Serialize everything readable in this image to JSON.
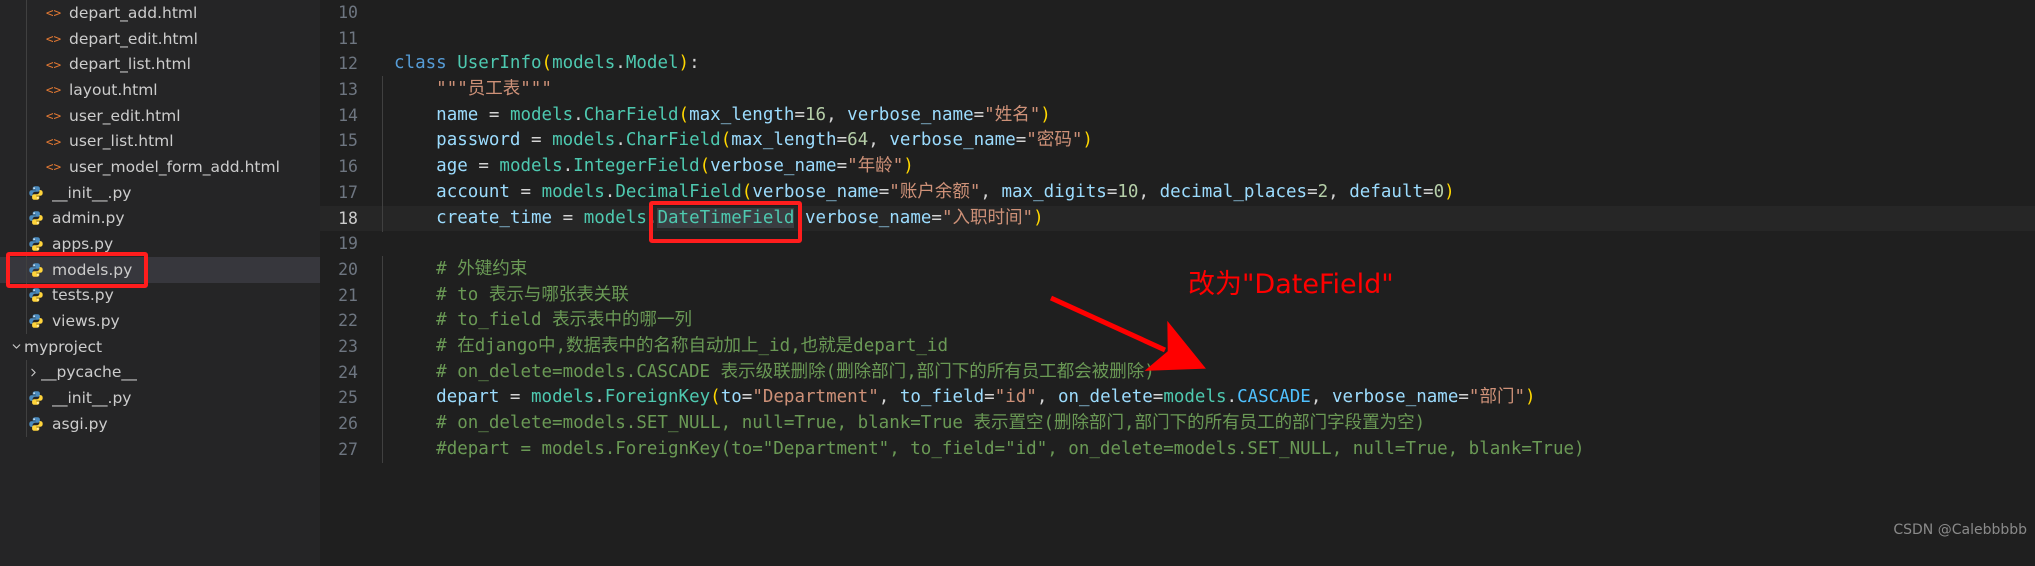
{
  "sidebar": {
    "items": [
      {
        "label": "depart_add.html",
        "icon": "html-icon",
        "indent": 2,
        "type": "html",
        "selected": false
      },
      {
        "label": "depart_edit.html",
        "icon": "html-icon",
        "indent": 2,
        "type": "html",
        "selected": false
      },
      {
        "label": "depart_list.html",
        "icon": "html-icon",
        "indent": 2,
        "type": "html",
        "selected": false
      },
      {
        "label": "layout.html",
        "icon": "html-icon",
        "indent": 2,
        "type": "html",
        "selected": false
      },
      {
        "label": "user_edit.html",
        "icon": "html-icon",
        "indent": 2,
        "type": "html",
        "selected": false
      },
      {
        "label": "user_list.html",
        "icon": "html-icon",
        "indent": 2,
        "type": "html",
        "selected": false
      },
      {
        "label": "user_model_form_add.html",
        "icon": "html-icon",
        "indent": 2,
        "type": "html",
        "selected": false
      },
      {
        "label": "__init__.py",
        "icon": "python-icon",
        "indent": 1,
        "type": "py",
        "selected": false
      },
      {
        "label": "admin.py",
        "icon": "python-icon",
        "indent": 1,
        "type": "py",
        "selected": false
      },
      {
        "label": "apps.py",
        "icon": "python-icon",
        "indent": 1,
        "type": "py",
        "selected": false
      },
      {
        "label": "models.py",
        "icon": "python-icon",
        "indent": 1,
        "type": "py",
        "selected": true
      },
      {
        "label": "tests.py",
        "icon": "python-icon",
        "indent": 1,
        "type": "py",
        "selected": false
      },
      {
        "label": "views.py",
        "icon": "python-icon",
        "indent": 1,
        "type": "py",
        "selected": false
      },
      {
        "label": "myproject",
        "icon": "chevron-down-icon",
        "indent": 0,
        "type": "folder-open",
        "selected": false
      },
      {
        "label": "__pycache__",
        "icon": "chevron-right-icon",
        "indent": 1,
        "type": "folder-closed",
        "selected": false
      },
      {
        "label": "__init__.py",
        "icon": "python-icon",
        "indent": 1,
        "type": "py",
        "selected": false
      },
      {
        "label": "asgi.py",
        "icon": "python-icon",
        "indent": 1,
        "type": "py",
        "selected": false
      }
    ],
    "highlight_target": "models.py"
  },
  "editor": {
    "first_line_number": 10,
    "current_line": 18,
    "selected_token": "DateTimeField",
    "lines": [
      {
        "n": 10,
        "text": ""
      },
      {
        "n": 11,
        "text": ""
      },
      {
        "n": 12,
        "text": "class UserInfo(models.Model):"
      },
      {
        "n": 13,
        "text": "    \"\"\"员工表\"\"\""
      },
      {
        "n": 14,
        "text": "    name = models.CharField(max_length=16, verbose_name=\"姓名\")"
      },
      {
        "n": 15,
        "text": "    password = models.CharField(max_length=64, verbose_name=\"密码\")"
      },
      {
        "n": 16,
        "text": "    age = models.IntegerField(verbose_name=\"年龄\")"
      },
      {
        "n": 17,
        "text": "    account = models.DecimalField(verbose_name=\"账户余额\", max_digits=10, decimal_places=2, default=0)"
      },
      {
        "n": 18,
        "text": "    create_time = models.DateTimeField(verbose_name=\"入职时间\")"
      },
      {
        "n": 19,
        "text": ""
      },
      {
        "n": 20,
        "text": "    # 外键约束"
      },
      {
        "n": 21,
        "text": "    # to 表示与哪张表关联"
      },
      {
        "n": 22,
        "text": "    # to_field 表示表中的哪一列"
      },
      {
        "n": 23,
        "text": "    # 在django中,数据表中的名称自动加上_id,也就是depart_id"
      },
      {
        "n": 24,
        "text": "    # on_delete=models.CASCADE 表示级联删除(删除部门,部门下的所有员工都会被删除)"
      },
      {
        "n": 25,
        "text": "    depart = models.ForeignKey(to=\"Department\", to_field=\"id\", on_delete=models.CASCADE, verbose_name=\"部门\")"
      },
      {
        "n": 26,
        "text": "    # on_delete=models.SET_NULL, null=True, blank=True 表示置空(删除部门,部门下的所有员工的部门字段置为空)"
      },
      {
        "n": 27,
        "text": "    #depart = models.ForeignKey(to=\"Department\", to_field=\"id\", on_delete=models.SET_NULL, null=True, blank=True)"
      }
    ]
  },
  "annotation": {
    "text": "改为\"DateField\"",
    "color": "#ff0000"
  },
  "watermark": {
    "text": "CSDN @Calebbbbb"
  },
  "colors": {
    "background": "#1f1f1f",
    "sidebar_background": "#252526",
    "selection": "#37373d",
    "keyword": "#569cd6",
    "class": "#4ec9b0",
    "string": "#ce9178",
    "number": "#b5cea8",
    "comment": "#6a9955",
    "variable": "#9cdcfe",
    "bracket": "#ffd700",
    "annotation_red": "#ff0000",
    "html_icon": "#e37933",
    "python_icon": "#3572a5"
  }
}
